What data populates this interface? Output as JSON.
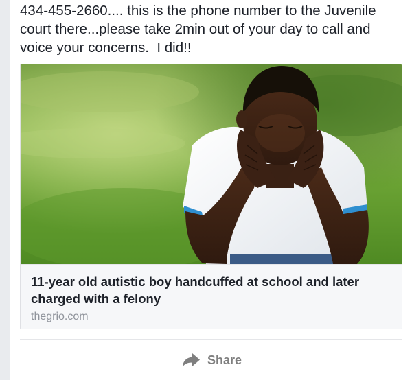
{
  "post": {
    "text": "434-455-2660.... this is the phone number to the Juvenile court there...please take 2min out of your day to call and voice your concerns.  I did!!"
  },
  "link_preview": {
    "title": "11-year old autistic boy handcuffed at school and later charged with a felony",
    "domain": "thegrio.com"
  },
  "actions": {
    "share_label": "Share",
    "share_icon": "share-arrow-icon"
  },
  "colors": {
    "text": "#1d2129",
    "muted": "#90949c",
    "card_footer": "#f6f7f9",
    "shirt_trim": "#2f8fd0"
  }
}
